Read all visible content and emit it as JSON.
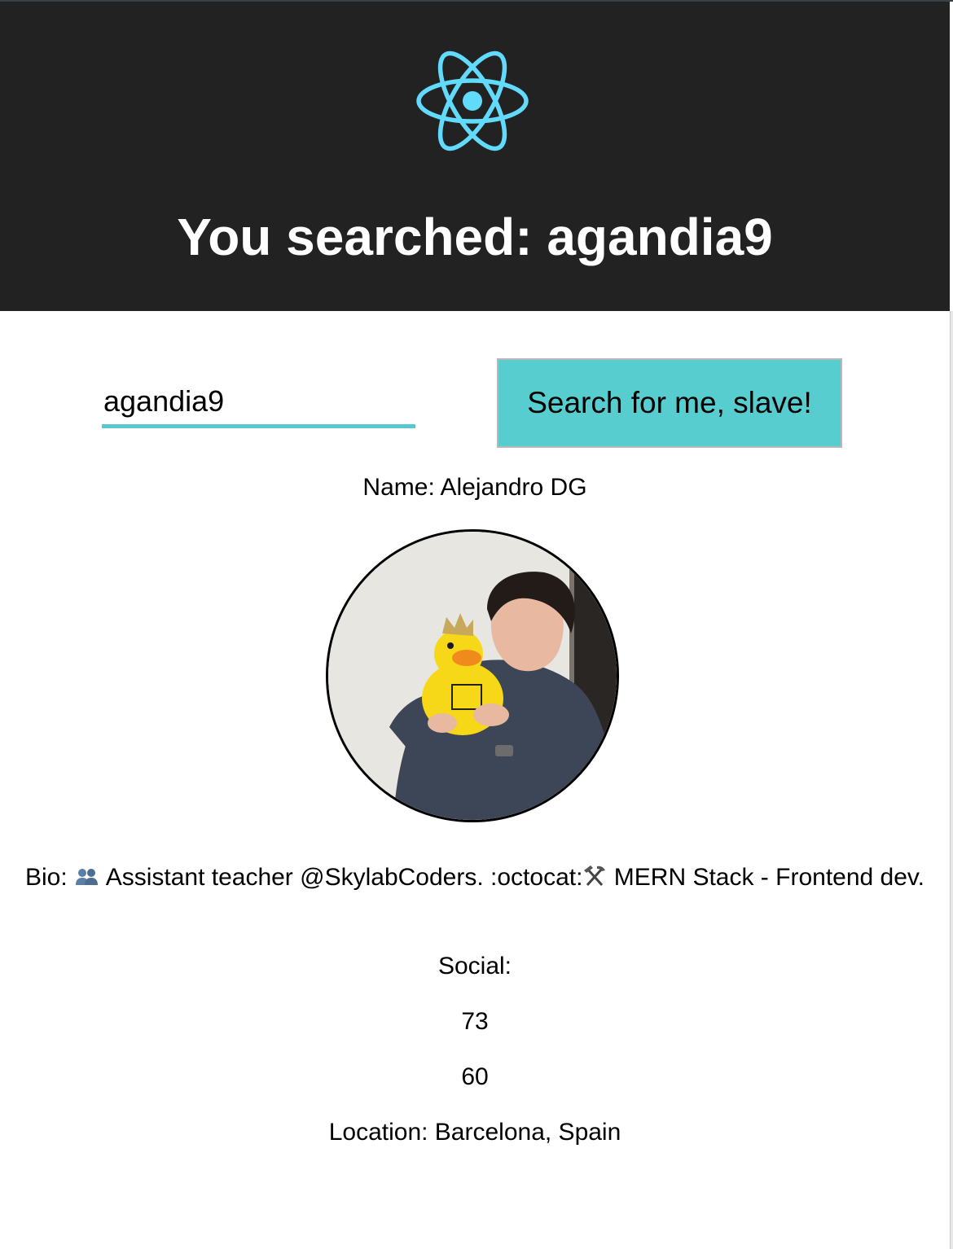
{
  "header": {
    "logo_icon": "react-atom-icon",
    "title": "You searched: agandia9",
    "background": "#222222",
    "logo_color": "#61dafb"
  },
  "search": {
    "value": "agandia9",
    "button_label": "Search for me, slave!",
    "accent": "#58cdcf"
  },
  "profile": {
    "name_line": "Name: Alejandro DG",
    "avatar_icon": "profile-photo",
    "bio_prefix": "Bio:",
    "bio_icon_1": "busts-in-silhouette-icon",
    "bio_text_1": "Assistant teacher @SkylabCoders.",
    "bio_text_2": ":octocat:",
    "bio_icon_2": "hammer-and-pick-icon",
    "bio_text_3": "MERN Stack - Frontend dev.",
    "social_label": "Social:",
    "followers": "73",
    "following": "60",
    "location_line": "Location: Barcelona, Spain"
  }
}
